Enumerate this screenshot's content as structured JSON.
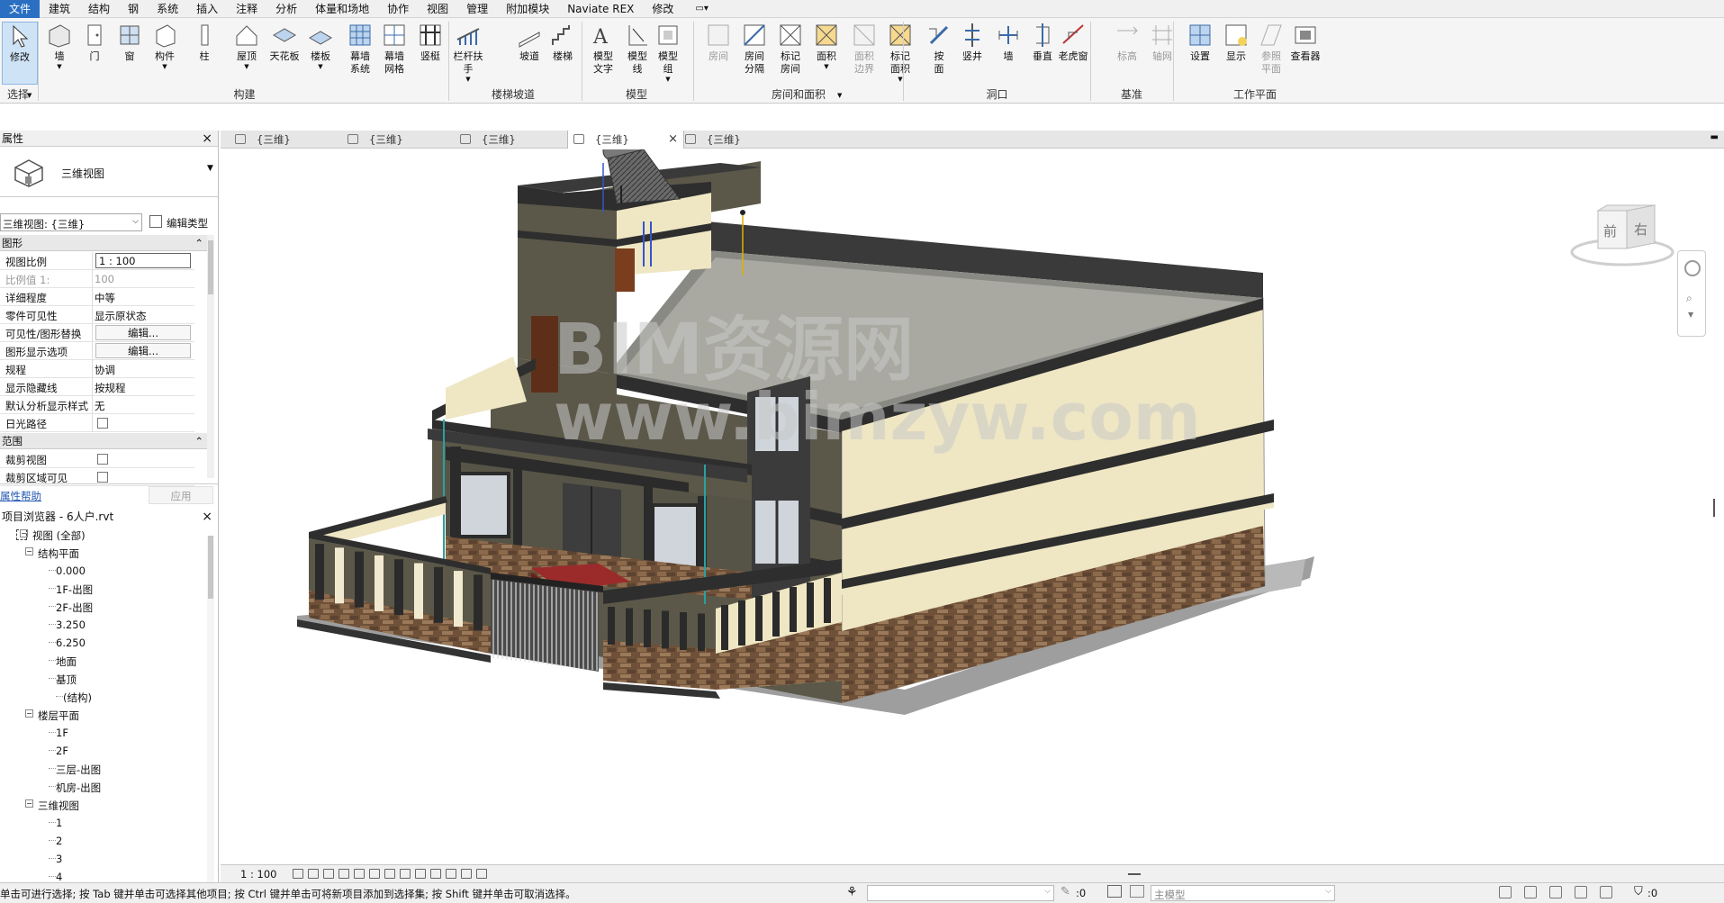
{
  "menu": [
    "文件",
    "建筑",
    "结构",
    "钢",
    "系统",
    "插入",
    "注释",
    "分析",
    "体量和场地",
    "协作",
    "视图",
    "管理",
    "附加模块",
    "Naviate REX",
    "修改"
  ],
  "ribbon": {
    "tools": [
      {
        "label": "修改",
        "icon": "modify-arrow-icon"
      },
      {
        "label": "墙",
        "icon": "wall-icon"
      },
      {
        "label": "门",
        "icon": "door-icon"
      },
      {
        "label": "窗",
        "icon": "window-icon"
      },
      {
        "label": "构件",
        "icon": "component-icon"
      },
      {
        "label": "柱",
        "icon": "column-icon"
      },
      {
        "label": "屋顶",
        "icon": "roof-icon"
      },
      {
        "label": "天花板",
        "icon": "ceiling-icon"
      },
      {
        "label": "楼板",
        "icon": "floor-icon"
      },
      {
        "label": "幕墙\n系统",
        "icon": "curtain-system-icon"
      },
      {
        "label": "幕墙\n网格",
        "icon": "curtain-grid-icon"
      },
      {
        "label": "竖梃",
        "icon": "mullion-icon"
      },
      {
        "label": "栏杆扶手",
        "icon": "railing-icon"
      },
      {
        "label": "坡道",
        "icon": "ramp-icon"
      },
      {
        "label": "楼梯",
        "icon": "stair-icon"
      },
      {
        "label": "模型\n文字",
        "icon": "model-text-icon"
      },
      {
        "label": "模型\n线",
        "icon": "model-line-icon"
      },
      {
        "label": "模型\n组",
        "icon": "model-group-icon"
      },
      {
        "label": "房间",
        "icon": "room-icon"
      },
      {
        "label": "房间\n分隔",
        "icon": "room-separator-icon"
      },
      {
        "label": "标记\n房间",
        "icon": "tag-room-icon"
      },
      {
        "label": "面积",
        "icon": "area-icon"
      },
      {
        "label": "面积\n边界",
        "icon": "area-boundary-icon"
      },
      {
        "label": "标记\n面积",
        "icon": "tag-area-icon"
      },
      {
        "label": "按\n面",
        "icon": "by-face-icon"
      },
      {
        "label": "竖井",
        "icon": "shaft-icon"
      },
      {
        "label": "墙",
        "icon": "wall-opening-icon"
      },
      {
        "label": "垂直",
        "icon": "vertical-opening-icon"
      },
      {
        "label": "老虎窗",
        "icon": "dormer-icon"
      },
      {
        "label": "标高",
        "icon": "level-icon"
      },
      {
        "label": "轴网",
        "icon": "grid-icon"
      },
      {
        "label": "设置",
        "icon": "set-workplane-icon"
      },
      {
        "label": "显示",
        "icon": "show-workplane-icon"
      },
      {
        "label": "参照\n平面",
        "icon": "ref-plane-icon"
      },
      {
        "label": "查看器",
        "icon": "viewer-icon"
      }
    ],
    "panels": [
      "选择",
      "构建",
      "楼梯坡道",
      "模型",
      "房间和面积",
      "洞口",
      "基准",
      "工作平面"
    ]
  },
  "properties": {
    "title": "属性",
    "type_name": "三维视图",
    "view_selector": "三维视图: {三维}",
    "edit_type": "编辑类型",
    "section_graphics": "图形",
    "rows": [
      {
        "k": "视图比例",
        "v": "1 : 100"
      },
      {
        "k": "比例值 1:",
        "v": "100"
      },
      {
        "k": "详细程度",
        "v": "中等"
      },
      {
        "k": "零件可见性",
        "v": "显示原状态"
      },
      {
        "k": "可见性/图形替换",
        "v": "编辑..."
      },
      {
        "k": "图形显示选项",
        "v": "编辑..."
      },
      {
        "k": "规程",
        "v": "协调"
      },
      {
        "k": "显示隐藏线",
        "v": "按规程"
      },
      {
        "k": "默认分析显示样式",
        "v": "无"
      },
      {
        "k": "日光路径",
        "v": ""
      }
    ],
    "section_extents": "范围",
    "rows2": [
      {
        "k": "裁剪视图",
        "v": ""
      },
      {
        "k": "裁剪区域可见",
        "v": ""
      }
    ],
    "help": "属性帮助",
    "apply": "应用"
  },
  "browser": {
    "title": "项目浏览器 - 6人户.rvt",
    "root": "视图 (全部)",
    "g1": "结构平面",
    "g1_items": [
      "0.000",
      "1F-出图",
      "2F-出图",
      "3.250",
      "6.250",
      "地面",
      "基顶",
      "(结构)"
    ],
    "g2": "楼层平面",
    "g2_items": [
      "1F",
      "2F",
      "三层-出图",
      "机房-出图"
    ],
    "g3": "三维视图",
    "g3_items": [
      "1",
      "2",
      "3",
      "4"
    ]
  },
  "tabs": [
    "{三维}",
    "{三维}",
    "{三维}",
    "{三维}",
    "{三维}"
  ],
  "viewcube": {
    "front": "前",
    "right": "右"
  },
  "viewbar": {
    "scale": "1 : 100"
  },
  "status": {
    "hint": "单击可进行选择; 按 Tab 键并单击可选择其他项目; 按 Ctrl 键并单击可将新项目添加到选择集; 按 Shift 键并单击可取消选择。",
    "zero1": ":0",
    "model": "主模型",
    "zero2": ":0"
  },
  "watermark": {
    "line1": "BIM资源网",
    "line2": "www.bimzyw.com"
  },
  "colors": {
    "accent": "#2b6fc2",
    "wall_dark": "#595648",
    "wall_light": "#ede5c5",
    "roof_edge": "#2e2e2e",
    "stone": "#7a5a40"
  }
}
